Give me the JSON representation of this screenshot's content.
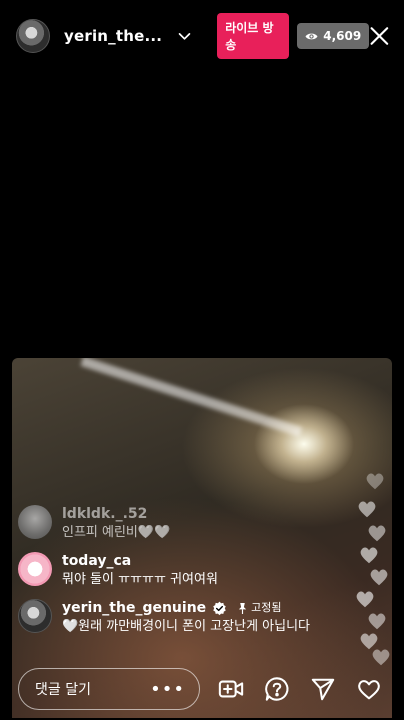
{
  "header": {
    "username": "yerin_the...",
    "live_label": "라이브 방송",
    "viewer_count": "4,609"
  },
  "comments": [
    {
      "username": "ldkldk._.52",
      "text": "인프피 예린비🤍🤍"
    },
    {
      "username": "today_ca",
      "text": "뭐야 둘이 ㅠㅠㅠㅠ 귀여여워"
    },
    {
      "username": "yerin_the_genuine",
      "pinned_label": "고정됨",
      "text": "🤍원래 까만배경이니 폰이 고장난게 아닙니다"
    }
  ],
  "bottom": {
    "comment_placeholder": "댓글 달기",
    "more_label": "•••"
  },
  "colors": {
    "live_badge": "#e8205a",
    "viewer_badge": "#6b6b6b",
    "background": "#000000"
  },
  "icons": [
    "chevron-down-icon",
    "eye-icon",
    "close-icon",
    "verified-icon",
    "pin-icon",
    "add-video-icon",
    "question-icon",
    "send-icon",
    "heart-icon"
  ]
}
